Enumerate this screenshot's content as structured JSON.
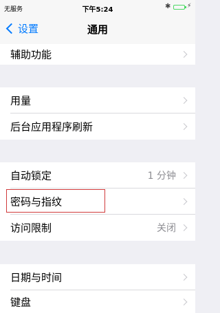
{
  "status_bar": {
    "carrier": "无服务",
    "time": "下午5:24",
    "bluetooth_icon": "bluetooth-icon",
    "battery_level": 1.0,
    "battery_color": "#4cd964"
  },
  "nav": {
    "back_label": "设置",
    "title": "通用",
    "accent_color": "#007aff"
  },
  "groups": [
    {
      "items": [
        {
          "label": "辅助功能",
          "value": ""
        }
      ]
    },
    {
      "items": [
        {
          "label": "用量",
          "value": ""
        },
        {
          "label": "后台应用程序刷新",
          "value": ""
        }
      ]
    },
    {
      "items": [
        {
          "label": "自动锁定",
          "value": "1 分钟"
        },
        {
          "label": "密码与指纹",
          "value": ""
        },
        {
          "label": "访问限制",
          "value": "关闭"
        }
      ]
    },
    {
      "items": [
        {
          "label": "日期与时间",
          "value": ""
        },
        {
          "label": "键盘",
          "value": ""
        }
      ]
    }
  ],
  "highlight_color": "#d0393a"
}
